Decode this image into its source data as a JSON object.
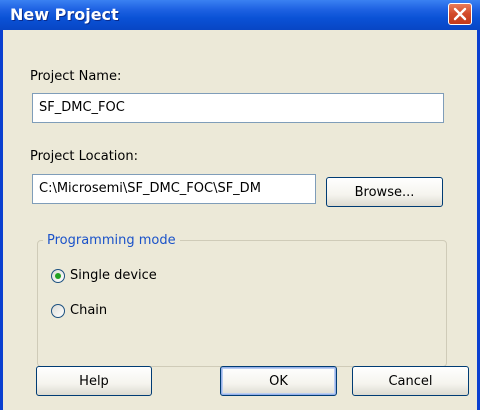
{
  "window": {
    "title": "New Project",
    "close_icon": "close-icon"
  },
  "form": {
    "project_name_label": "Project Name:",
    "project_name_value": "SF_DMC_FOC",
    "project_location_label": "Project Location:",
    "project_location_value": "C:\\Microsemi\\SF_DMC_FOC\\SF_DM",
    "browse_label": "Browse...",
    "programming_mode_label": "Programming mode",
    "modes": [
      {
        "label": "Single device",
        "selected": true
      },
      {
        "label": "Chain",
        "selected": false
      }
    ]
  },
  "buttons": {
    "help": "Help",
    "ok": "OK",
    "cancel": "Cancel"
  },
  "colors": {
    "titlebar": "#0a52d6",
    "close": "#d24a2a",
    "dialog_bg": "#ece9d8",
    "group_label": "#1a52c9",
    "radio_selected": "#21a121"
  }
}
